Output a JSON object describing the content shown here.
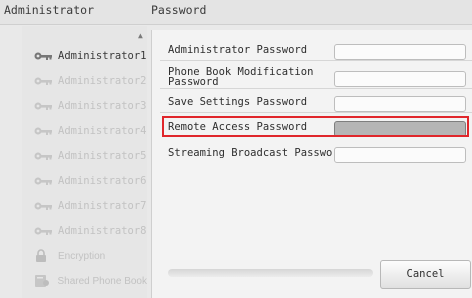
{
  "header": {
    "left_title": "Administrator",
    "right_title": "Password"
  },
  "sidebar": {
    "items": [
      {
        "label": "Administrator1",
        "icon": "key-icon",
        "state": "active"
      },
      {
        "label": "Administrator2",
        "icon": "key-icon",
        "state": "dim"
      },
      {
        "label": "Administrator3",
        "icon": "key-icon",
        "state": "dim"
      },
      {
        "label": "Administrator4",
        "icon": "key-icon",
        "state": "dim"
      },
      {
        "label": "Administrator5",
        "icon": "key-icon",
        "state": "dim"
      },
      {
        "label": "Administrator6",
        "icon": "key-icon",
        "state": "dim"
      },
      {
        "label": "Administrator7",
        "icon": "key-icon",
        "state": "dim"
      },
      {
        "label": "Administrator8",
        "icon": "key-icon",
        "state": "dim"
      },
      {
        "label": "Encryption",
        "icon": "lock-icon",
        "state": "dim"
      },
      {
        "label": "Shared Phone Book",
        "icon": "phonebook-icon",
        "state": "dim"
      }
    ]
  },
  "password": {
    "rows": [
      {
        "label": "Administrator Password",
        "value": ""
      },
      {
        "label": "Phone Book Modification Password",
        "value": ""
      },
      {
        "label": "Save Settings Password",
        "value": ""
      },
      {
        "label": "Remote Access Password",
        "value": "",
        "selected": true
      },
      {
        "label": "Streaming Broadcast Password",
        "value": ""
      }
    ]
  },
  "buttons": {
    "cancel": "Cancel"
  },
  "colors": {
    "highlight": "#e0262b",
    "selected_field": "#b5b5b5",
    "dim_text": "#c2c2c2"
  }
}
